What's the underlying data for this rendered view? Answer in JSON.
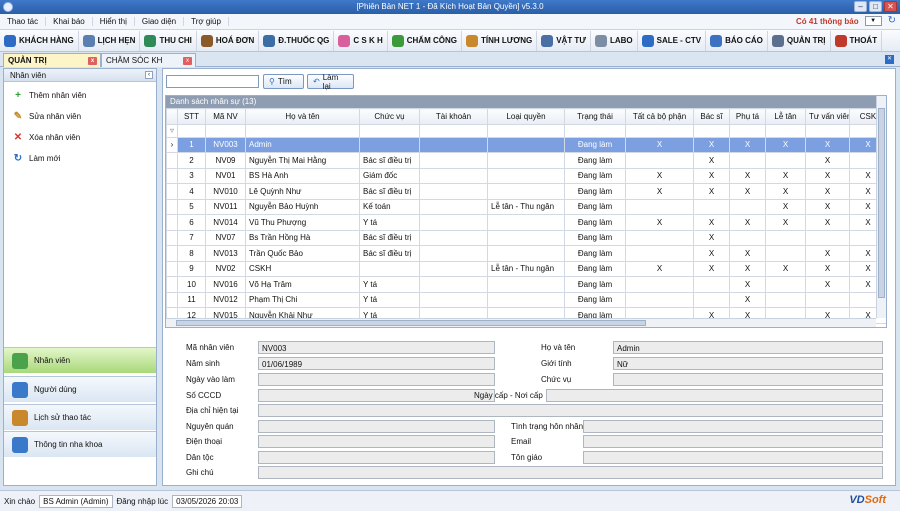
{
  "window": {
    "title": "[Phiên Bản NET 1 - Đã Kích Hoạt Bản Quyền] v5.3.0",
    "minimize": "–",
    "maximize": "□",
    "close": "✕"
  },
  "menu": {
    "items": [
      "Thao tác",
      "Khai báo",
      "Hiển thị",
      "Giao diện",
      "Trợ giúp"
    ],
    "notification": "Có 41 thông báo"
  },
  "toolbar": {
    "items": [
      {
        "label": "KHÁCH HÀNG",
        "icon": "users-icon",
        "color": "#2d6bc4"
      },
      {
        "label": "LỊCH HẸN",
        "icon": "calendar-icon",
        "color": "#5a7fb0"
      },
      {
        "label": "THU CHI",
        "icon": "dollar-icon",
        "color": "#2e8b57"
      },
      {
        "label": "HOÁ ĐƠN",
        "icon": "invoice-icon",
        "color": "#8a5a2b"
      },
      {
        "label": "Đ.THUỐC QG",
        "icon": "medicine-icon",
        "color": "#3a6ea5"
      },
      {
        "label": "C S K H",
        "icon": "care-icon",
        "color": "#d9609a"
      },
      {
        "label": "CHẤM CÔNG",
        "icon": "check-shield-icon",
        "color": "#3b9b3b"
      },
      {
        "label": "TÍNH LƯƠNG",
        "icon": "salary-icon",
        "color": "#c9882b"
      },
      {
        "label": "VẬT TƯ",
        "icon": "tools-icon",
        "color": "#4a6fa5"
      },
      {
        "label": "LABO",
        "icon": "tooth-icon",
        "color": "#7d8da3"
      },
      {
        "label": "SALE - CTV",
        "icon": "sale-icon",
        "color": "#2d6bc4"
      },
      {
        "label": "BÁO CÁO",
        "icon": "report-icon",
        "color": "#3d72c2"
      },
      {
        "label": "QUẢN TRỊ",
        "icon": "gear-icon",
        "color": "#5b6f8e"
      },
      {
        "label": "THOÁT",
        "icon": "exit-icon",
        "color": "#c0392b"
      }
    ]
  },
  "tabs": [
    {
      "label": "QUẢN TRỊ",
      "close": "x"
    },
    {
      "label": "CHĂM SÓC KH",
      "close": "x"
    }
  ],
  "left_panel": {
    "header": "Nhân viên",
    "actions": [
      {
        "label": "Thêm nhân viên",
        "icon": "add-icon",
        "glyph": "+",
        "color": "#2e9e3a"
      },
      {
        "label": "Sửa nhân viên",
        "icon": "edit-icon",
        "glyph": "✎",
        "color": "#c9882b"
      },
      {
        "label": "Xóa nhân viên",
        "icon": "delete-icon",
        "glyph": "✕",
        "color": "#d9342b"
      },
      {
        "label": "Làm mới",
        "icon": "refresh-icon",
        "glyph": "↻",
        "color": "#2d6bc4"
      }
    ],
    "nav": [
      "Nhân viên",
      "Người dùng",
      "Lịch sử thao tác",
      "Thông tin nha khoa"
    ]
  },
  "search": {
    "value": "",
    "find_label": "Tìm",
    "reset_label": "Làm lại"
  },
  "grid": {
    "caption": "Danh sách nhân sự (13)",
    "columns": [
      "STT",
      "Mã NV",
      "Họ và tên",
      "Chức vụ",
      "Tài khoản",
      "Loại quyền",
      "Trạng thái",
      "Tất cả bộ phận",
      "Bác sĩ",
      "Phụ tá",
      "Lễ tân",
      "Tư vấn viên",
      "CSK"
    ],
    "rows": [
      [
        "1",
        "NV003",
        "Admin",
        "",
        "",
        "",
        "Đang làm",
        "X",
        "X",
        "X",
        "X",
        "X",
        "X"
      ],
      [
        "2",
        "NV09",
        "Nguyễn Thị Mai Hằng",
        "Bác sĩ điều trị",
        "",
        "",
        "Đang làm",
        "",
        "X",
        "",
        "",
        "X",
        ""
      ],
      [
        "3",
        "NV01",
        "BS Hà Anh",
        "Giám đốc",
        "",
        "",
        "Đang làm",
        "X",
        "X",
        "X",
        "X",
        "X",
        "X"
      ],
      [
        "4",
        "NV010",
        "Lê Quỳnh Như",
        "Bác sĩ điều trị",
        "",
        "",
        "Đang làm",
        "X",
        "X",
        "X",
        "X",
        "X",
        "X"
      ],
      [
        "5",
        "NV011",
        "Nguyễn Bảo Huỳnh",
        "Kế toán",
        "",
        "Lễ tân - Thu ngân",
        "Đang làm",
        "",
        "",
        "",
        "X",
        "X",
        "X"
      ],
      [
        "6",
        "NV014",
        "Vũ Thu Phượng",
        "Y tá",
        "",
        "",
        "Đang làm",
        "X",
        "X",
        "X",
        "X",
        "X",
        "X"
      ],
      [
        "7",
        "NV07",
        "Bs Trần Hồng Hà",
        "Bác sĩ điều trị",
        "",
        "",
        "Đang làm",
        "",
        "X",
        "",
        "",
        "",
        ""
      ],
      [
        "8",
        "NV013",
        "Trần Quốc Bảo",
        "Bác sĩ điều trị",
        "",
        "",
        "Đang làm",
        "",
        "X",
        "X",
        "",
        "X",
        "X"
      ],
      [
        "9",
        "NV02",
        "CSKH",
        "",
        "",
        "Lễ tân - Thu ngân",
        "Đang làm",
        "X",
        "X",
        "X",
        "X",
        "X",
        "X"
      ],
      [
        "10",
        "NV016",
        "Võ Hạ Trâm",
        "Y tá",
        "",
        "",
        "Đang làm",
        "",
        "",
        "X",
        "",
        "X",
        "X"
      ],
      [
        "11",
        "NV012",
        "Phạm Thị Chi",
        "Y tá",
        "",
        "",
        "Đang làm",
        "",
        "",
        "X",
        "",
        "",
        ""
      ],
      [
        "12",
        "NV015",
        "Nguyễn Khải Như",
        "Y tá",
        "",
        "",
        "Đang làm",
        "",
        "X",
        "X",
        "",
        "X",
        "X"
      ]
    ]
  },
  "detail": {
    "ma_nv": {
      "label": "Mã nhân viên",
      "value": "NV003"
    },
    "ho_ten": {
      "label": "Họ và tên",
      "value": "Admin"
    },
    "nam_sinh": {
      "label": "Năm sinh",
      "value": "01/06/1989"
    },
    "gioi_tinh": {
      "label": "Giới tính",
      "value": "Nữ"
    },
    "ngay_vao": {
      "label": "Ngày vào làm",
      "value": ""
    },
    "chuc_vu": {
      "label": "Chức vụ",
      "value": ""
    },
    "cccd": {
      "label": "Số CCCD",
      "value": ""
    },
    "ngay_cap": {
      "label": "Ngày cấp - Nơi cấp",
      "value": ""
    },
    "dia_chi": {
      "label": "Địa chỉ hiện tại",
      "value": ""
    },
    "nguyen_quan": {
      "label": "Nguyên quán",
      "value": ""
    },
    "hon_nhan": {
      "label": "Tình trạng hôn nhân",
      "value": ""
    },
    "dien_thoai": {
      "label": "Điện thoại",
      "value": ""
    },
    "email": {
      "label": "Email",
      "value": ""
    },
    "dan_toc": {
      "label": "Dân tộc",
      "value": ""
    },
    "ton_giao": {
      "label": "Tôn giáo",
      "value": ""
    },
    "ghi_chu": {
      "label": "Ghi chú",
      "value": ""
    }
  },
  "status": {
    "greeting": "Xin chào",
    "user": "BS Admin (Admin)",
    "login_label": "Đăng nhập lúc",
    "login_time": "03/05/2026 20:03",
    "brand_a": "VD",
    "brand_b": "Soft"
  }
}
